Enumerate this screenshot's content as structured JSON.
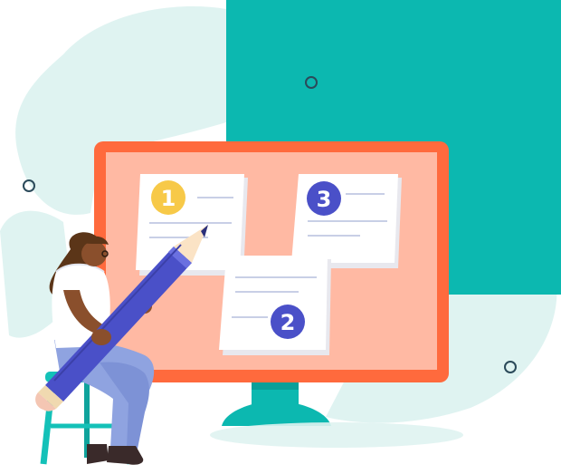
{
  "notes": [
    {
      "number": "1",
      "badge_color": "#f7c948"
    },
    {
      "number": "3",
      "badge_color": "#4a50c8"
    },
    {
      "number": "2",
      "badge_color": "#4a50c8"
    }
  ],
  "colors": {
    "teal": "#0cb8b0",
    "mint_blob": "#dff3f1",
    "monitor_frame": "#ff6a3d",
    "screen": "#ffb9a3",
    "note_paper": "#ffffff",
    "note_line": "#c8cfe6",
    "pencil_body": "#4a50c8",
    "skin": "#8a4f2c",
    "hair": "#5b3518",
    "pants": "#8fa3e0",
    "stool": "#14c1b8"
  }
}
